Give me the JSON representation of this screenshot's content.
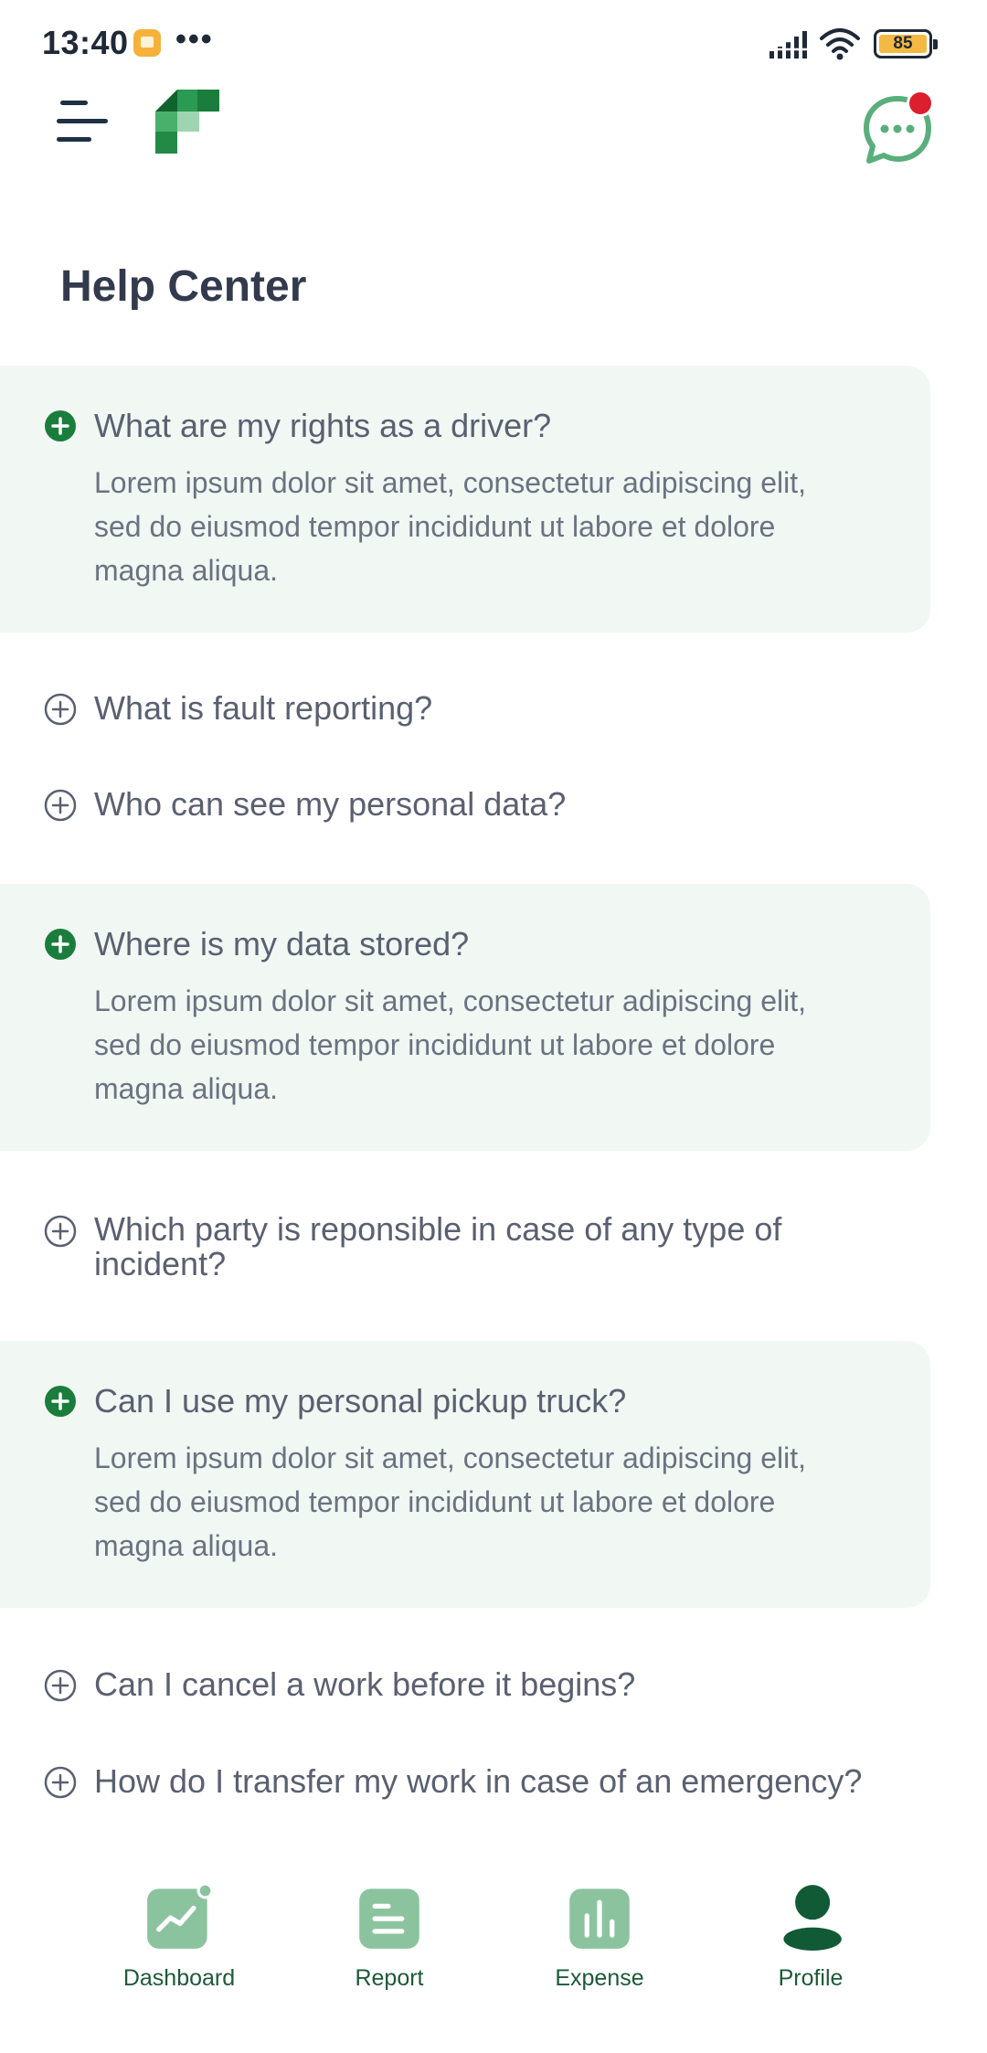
{
  "status_bar": {
    "time": "13:40",
    "more_indicator": "•••",
    "battery_level": "85",
    "icons": [
      "notification-app-icon",
      "signal-icon",
      "wifi-icon",
      "battery-icon"
    ]
  },
  "header": {
    "menu_icon": "hamburger-menu-icon",
    "logo_icon": "app-logo",
    "chat_icon": "chat-bubble-icon",
    "chat_has_notification": true
  },
  "page": {
    "title": "Help Center"
  },
  "faqs": [
    {
      "question": "What are my rights as a driver?",
      "answer": "Lorem ipsum dolor sit amet, consectetur adipiscing elit, sed do eiusmod tempor incididunt ut labore et dolore magna aliqua.",
      "expanded": true
    },
    {
      "question": "What is fault reporting?",
      "expanded": false
    },
    {
      "question": "Who can see my personal data?",
      "expanded": false
    },
    {
      "question": "Where is my data stored?",
      "answer": "Lorem ipsum dolor sit amet, consectetur adipiscing elit, sed do eiusmod tempor incididunt ut labore et dolore magna aliqua.",
      "expanded": true
    },
    {
      "question": "Which party is reponsible in case of any type of incident?",
      "expanded": false
    },
    {
      "question": "Can I use my personal pickup truck?",
      "answer": "Lorem ipsum dolor sit amet, consectetur adipiscing elit, sed do eiusmod tempor incididunt ut labore et dolore magna aliqua.",
      "expanded": true
    },
    {
      "question": "Can I cancel a work before it begins?",
      "expanded": false
    },
    {
      "question": "How do I transfer my work in case of an emergency?",
      "expanded": false
    }
  ],
  "bottom_nav": {
    "items": [
      {
        "label": "Dashboard",
        "icon": "dashboard-chart-icon",
        "has_badge": true
      },
      {
        "label": "Report",
        "icon": "report-document-icon"
      },
      {
        "label": "Expense",
        "icon": "expense-bars-icon"
      },
      {
        "label": "Profile",
        "icon": "profile-person-icon",
        "active": true
      }
    ]
  },
  "colors": {
    "brand_green": "#1a7d3c",
    "expanded_bg": "#f1f7f3",
    "nav_icon_bg": "#8cc39f",
    "badge_red": "#dc1f2e",
    "title_text": "#333a4d"
  }
}
